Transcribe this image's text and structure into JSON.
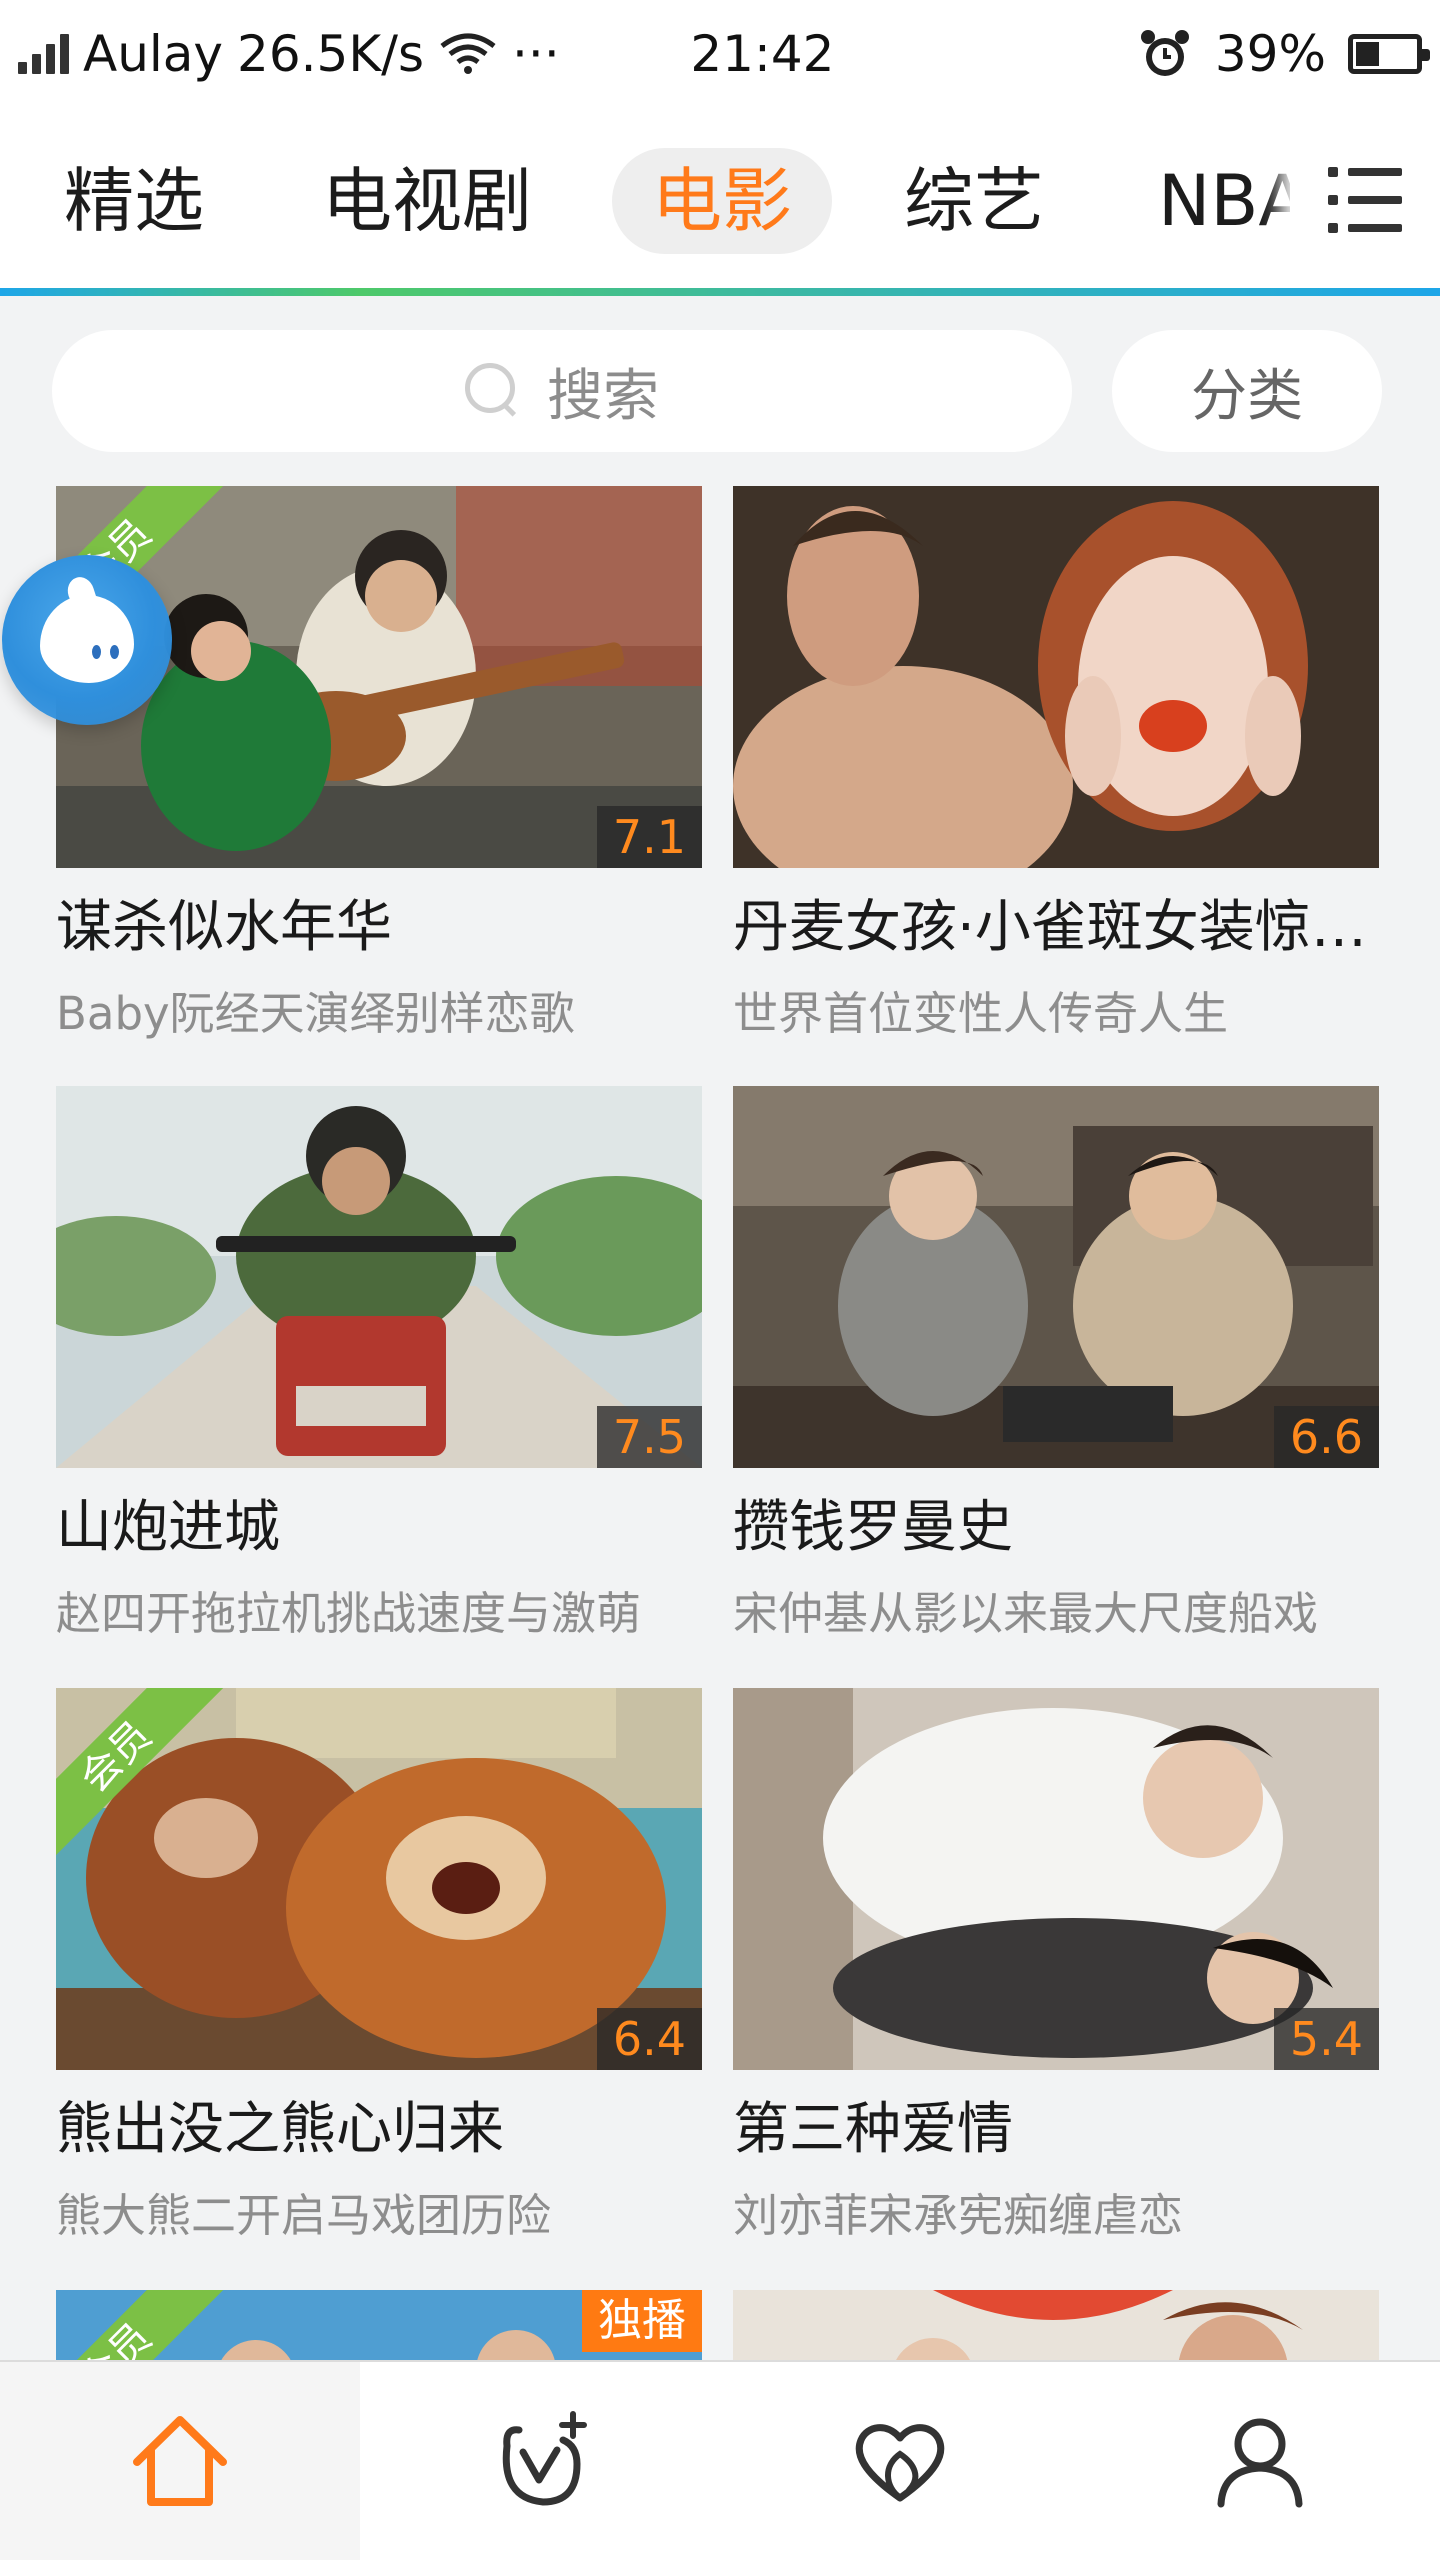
{
  "status_bar": {
    "carrier": "Aulay",
    "speed": "26.5K/s",
    "more": "···",
    "time": "21:42",
    "battery_percent": "39%",
    "battery_level": 0.39
  },
  "top_tabs": [
    {
      "label": "精选"
    },
    {
      "label": "电视剧"
    },
    {
      "label": "电影",
      "active": true
    },
    {
      "label": "综艺"
    },
    {
      "label": "NBA"
    }
  ],
  "search": {
    "placeholder": "搜索"
  },
  "category_button": "分类",
  "movies": [
    {
      "title": "谋杀似水年华",
      "subtitle": "Baby阮经天演绎别样恋歌",
      "score": "7.1",
      "badge": "会员"
    },
    {
      "title": "丹麦女孩·小雀斑女装惊艳出镜",
      "subtitle": "世界首位变性人传奇人生",
      "score": ""
    },
    {
      "title": "山炮进城",
      "subtitle": "赵四开拖拉机挑战速度与激萌",
      "score": "7.5"
    },
    {
      "title": "攒钱罗曼史",
      "subtitle": "宋仲基从影以来最大尺度船戏",
      "score": "6.6"
    },
    {
      "title": "熊出没之熊心归来",
      "subtitle": "熊大熊二开启马戏团历险",
      "score": "6.4",
      "badge": "会员"
    },
    {
      "title": "第三种爱情",
      "subtitle": "刘亦菲宋承宪痴缠虐恋",
      "score": "5.4"
    },
    {
      "badge": "会员",
      "exclusive": "独播"
    },
    {}
  ],
  "colors": {
    "accent_orange": "#ff7a1a",
    "vip_green": "#7cc045",
    "tab_underline": "#1ea6e8"
  },
  "bottom_nav": [
    {
      "icon": "home-icon",
      "active": true
    },
    {
      "icon": "vlog-add-icon"
    },
    {
      "icon": "heart-icon"
    },
    {
      "icon": "user-icon"
    }
  ]
}
